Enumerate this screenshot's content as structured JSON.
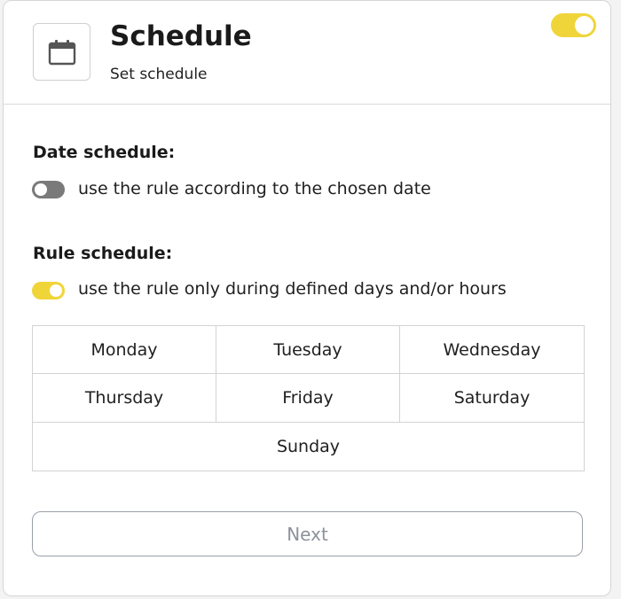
{
  "header": {
    "title": "Schedule",
    "subtitle": "Set schedule",
    "icon": "calendar-icon",
    "enabled": true
  },
  "date_schedule": {
    "label": "Date schedule:",
    "option_text": "use the rule according to the chosen date",
    "enabled": false
  },
  "rule_schedule": {
    "label": "Rule schedule:",
    "option_text": "use the rule only during defined days and/or hours",
    "enabled": true,
    "days": [
      "Monday",
      "Tuesday",
      "Wednesday",
      "Thursday",
      "Friday",
      "Saturday",
      "Sunday"
    ]
  },
  "footer": {
    "next_label": "Next"
  },
  "colors": {
    "toggle_on": "#f0d53a",
    "toggle_off": "#7a7a7a",
    "button_text": "#8c929b"
  }
}
